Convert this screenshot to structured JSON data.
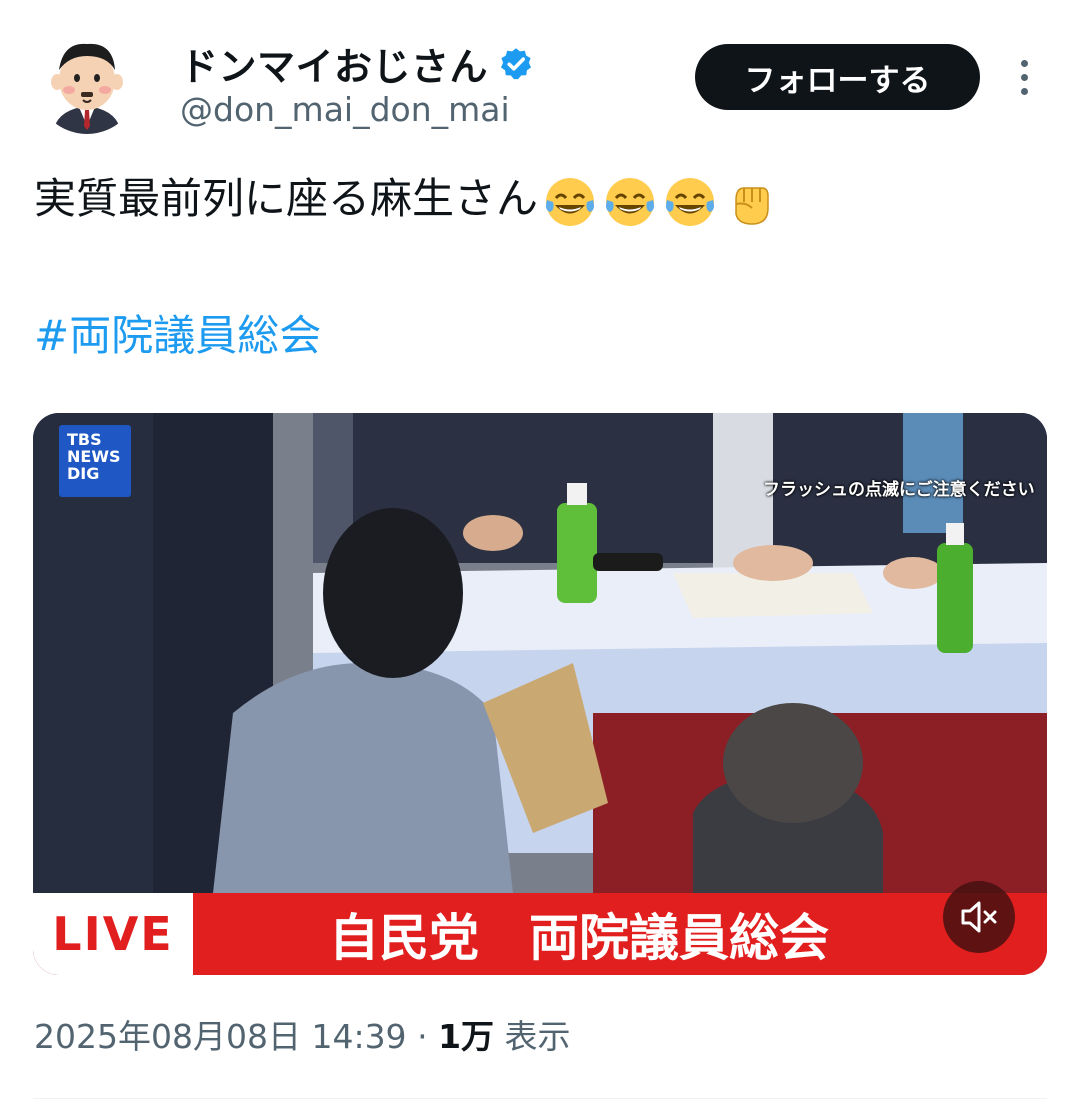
{
  "author": {
    "display_name": "ドンマイおじさん",
    "handle": "@don_mai_don_mai",
    "verified": true,
    "avatar_icon": "cartoon-man-in-suit"
  },
  "actions": {
    "follow_label": "フォローする",
    "more_icon": "vertical-ellipsis-icon"
  },
  "tweet": {
    "text": "実質最前列に座る麻生さん",
    "emojis": [
      "😂",
      "😂",
      "😂",
      "✊"
    ],
    "hashtag": "#両院議員総会"
  },
  "video": {
    "logo_lines": [
      "TBS",
      "NEWS",
      "DIG"
    ],
    "flash_warning": "フラッシュの点滅にご注意ください",
    "live_label": "LIVE",
    "lower_title": "自民党　両院議員総会",
    "mute_icon": "speaker-muted-icon",
    "accent_color": "#e21f1f"
  },
  "meta": {
    "timestamp": "2025年08月08日 14:39",
    "separator": "·",
    "views_count": "1万",
    "views_label": "表示"
  },
  "colors": {
    "link": "#1d9bf0",
    "secondary_text": "#536471",
    "verified_badge": "#1d9bf0"
  }
}
